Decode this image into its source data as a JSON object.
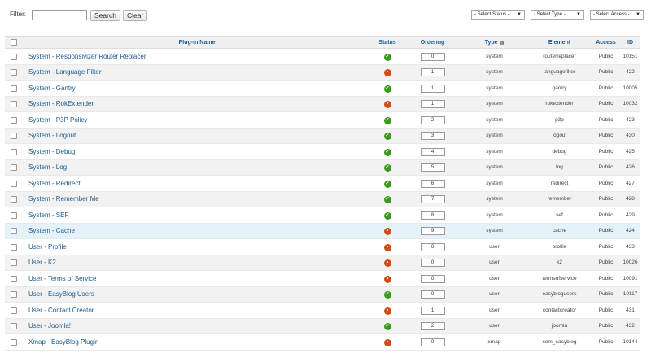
{
  "toolbar": {
    "filter_label": "Filter:",
    "filter_value": "",
    "search_label": "Search",
    "clear_label": "Clear",
    "status_select": "- Select Status -",
    "type_select": "- Select Type -",
    "access_select": "- Select Access -"
  },
  "columns": {
    "name": "Plug-in Name",
    "status": "Status",
    "ordering": "Ordering",
    "type": "Type",
    "element": "Element",
    "access": "Access",
    "id": "ID"
  },
  "colors": {
    "enabled": "#3a9a1b",
    "disabled": "#d24a16",
    "link": "#1b5a8e"
  },
  "rows": [
    {
      "name": "System - Responsivizer Router Replacer",
      "status": "enabled",
      "ordering": "0",
      "type": "system",
      "element": "routerreplacer",
      "access": "Public",
      "id": "10151"
    },
    {
      "name": "System - Language Filter",
      "status": "disabled",
      "ordering": "1",
      "type": "system",
      "element": "languagefilter",
      "access": "Public",
      "id": "422"
    },
    {
      "name": "System - Gantry",
      "status": "enabled",
      "ordering": "1",
      "type": "system",
      "element": "gantry",
      "access": "Public",
      "id": "10005"
    },
    {
      "name": "System - RokExtender",
      "status": "disabled",
      "ordering": "1",
      "type": "system",
      "element": "rokextender",
      "access": "Public",
      "id": "10032"
    },
    {
      "name": "System - P3P Policy",
      "status": "enabled",
      "ordering": "2",
      "type": "system",
      "element": "p3p",
      "access": "Public",
      "id": "423"
    },
    {
      "name": "System - Logout",
      "status": "enabled",
      "ordering": "3",
      "type": "system",
      "element": "logout",
      "access": "Public",
      "id": "430"
    },
    {
      "name": "System - Debug",
      "status": "enabled",
      "ordering": "4",
      "type": "system",
      "element": "debug",
      "access": "Public",
      "id": "425"
    },
    {
      "name": "System - Log",
      "status": "enabled",
      "ordering": "5",
      "type": "system",
      "element": "log",
      "access": "Public",
      "id": "426"
    },
    {
      "name": "System - Redirect",
      "status": "enabled",
      "ordering": "6",
      "type": "system",
      "element": "redirect",
      "access": "Public",
      "id": "427"
    },
    {
      "name": "System - Remember Me",
      "status": "enabled",
      "ordering": "7",
      "type": "system",
      "element": "remember",
      "access": "Public",
      "id": "428"
    },
    {
      "name": "System - SEF",
      "status": "enabled",
      "ordering": "8",
      "type": "system",
      "element": "sef",
      "access": "Public",
      "id": "429"
    },
    {
      "name": "System - Cache",
      "status": "disabled",
      "ordering": "9",
      "type": "system",
      "element": "cache",
      "access": "Public",
      "id": "424"
    },
    {
      "name": "User - Profile",
      "status": "disabled",
      "ordering": "0",
      "type": "user",
      "element": "profile",
      "access": "Public",
      "id": "433"
    },
    {
      "name": "User - K2",
      "status": "disabled",
      "ordering": "0",
      "type": "user",
      "element": "k2",
      "access": "Public",
      "id": "10026"
    },
    {
      "name": "User - Terms of Service",
      "status": "disabled",
      "ordering": "0",
      "type": "user",
      "element": "termsofservice",
      "access": "Public",
      "id": "10091"
    },
    {
      "name": "User - EasyBlog Users",
      "status": "enabled",
      "ordering": "0",
      "type": "user",
      "element": "easyblogusers",
      "access": "Public",
      "id": "10117"
    },
    {
      "name": "User - Contact Creator",
      "status": "disabled",
      "ordering": "1",
      "type": "user",
      "element": "contactcreator",
      "access": "Public",
      "id": "431"
    },
    {
      "name": "User - Joomla!",
      "status": "enabled",
      "ordering": "2",
      "type": "user",
      "element": "joomla",
      "access": "Public",
      "id": "432"
    },
    {
      "name": "Xmap - EasyBlog Plugin",
      "status": "disabled",
      "ordering": "0",
      "type": "xmap",
      "element": "com_easyblog",
      "access": "Public",
      "id": "10144"
    }
  ]
}
